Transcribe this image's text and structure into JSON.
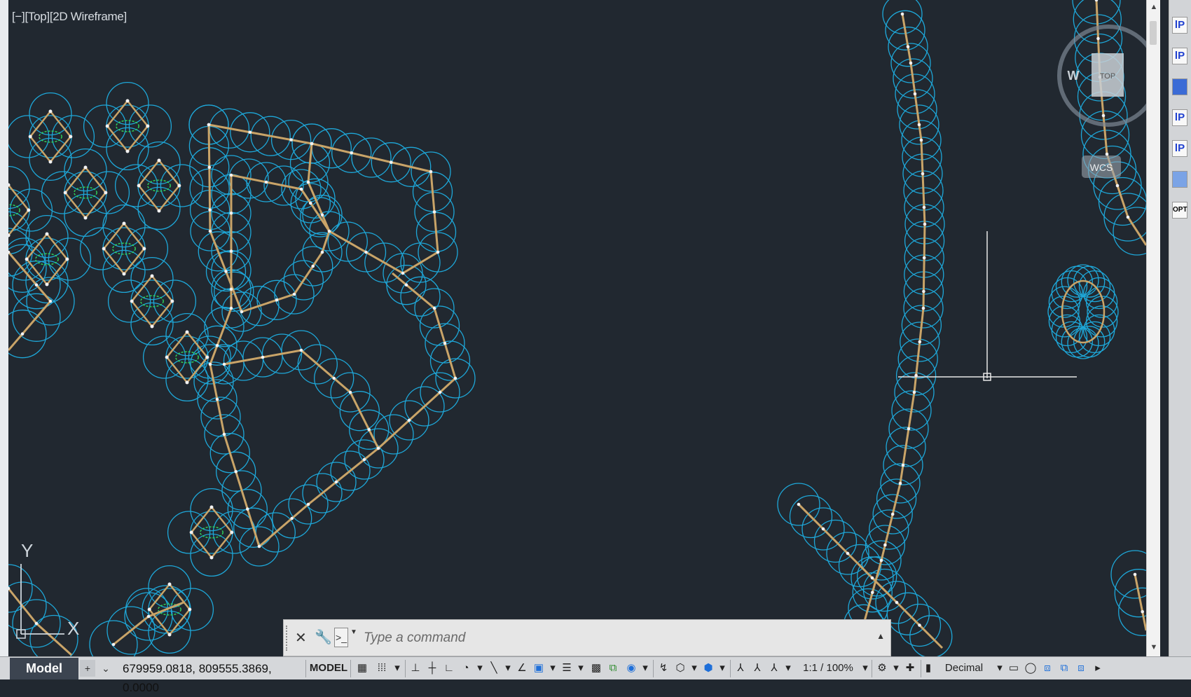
{
  "viewport": {
    "controls_label": "[−][Top][2D Wireframe]",
    "viewcube": {
      "west_label": "W",
      "top_label": "TOP"
    },
    "wcs_label": "WCS",
    "ucs_y_label": "Y",
    "ucs_x_label": "X"
  },
  "command_line": {
    "placeholder": "Type a command",
    "prompt_icon": "prompt-icon"
  },
  "layout_tabs": [
    {
      "label": "Model"
    }
  ],
  "add_tab_label": "+",
  "status": {
    "coordinates": "679959.0818, 809555.3869, 0.0000",
    "mode_label": "MODEL",
    "scale_label": "1:1 / 100%",
    "units_label": "Decimal"
  },
  "right_toolbar": {
    "icons": [
      "lp-icon",
      "lp-icon",
      "image-icon",
      "lp-icon",
      "lp-icon",
      "layers-icon",
      "opt-icon"
    ],
    "labels": [
      "lP",
      "lP",
      "",
      "lP",
      "lP",
      "",
      "OPT"
    ]
  },
  "colors": {
    "background": "#212830",
    "circles": "#1ea7d8",
    "polyline": "#c9a468",
    "accent_green": "#2fd05a"
  }
}
